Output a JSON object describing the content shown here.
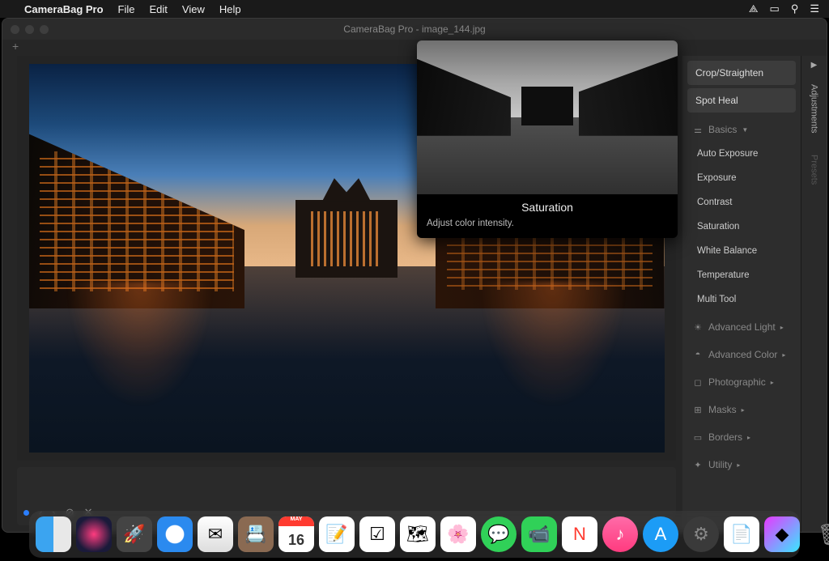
{
  "menubar": {
    "app_name": "CameraBag Pro",
    "items": [
      "File",
      "Edit",
      "View",
      "Help"
    ]
  },
  "window": {
    "title": "CameraBag Pro - image_144.jpg",
    "tab_plus": "+"
  },
  "panel": {
    "buttons": [
      "Crop/Straighten",
      "Spot Heal"
    ],
    "basics": {
      "label": "Basics",
      "items": [
        "Auto Exposure",
        "Exposure",
        "Contrast",
        "Saturation",
        "White Balance",
        "Temperature",
        "Multi Tool"
      ]
    },
    "sections": [
      {
        "label": "Advanced Light",
        "icon": "☀"
      },
      {
        "label": "Advanced Color",
        "icon": "◓"
      },
      {
        "label": "Photographic",
        "icon": "◻"
      },
      {
        "label": "Masks",
        "icon": "⊞"
      },
      {
        "label": "Borders",
        "icon": "▭"
      },
      {
        "label": "Utility",
        "icon": "✦"
      }
    ]
  },
  "side_tabs": {
    "adjustments": "Adjustments",
    "presets": "Presets"
  },
  "tooltip": {
    "title": "Saturation",
    "desc": "Adjust color intensity."
  },
  "strip": {
    "controls": [
      "‹",
      "›",
      "⊘",
      "✕"
    ]
  },
  "dock": {
    "calendar_month": "MAY",
    "calendar_day": "16"
  }
}
